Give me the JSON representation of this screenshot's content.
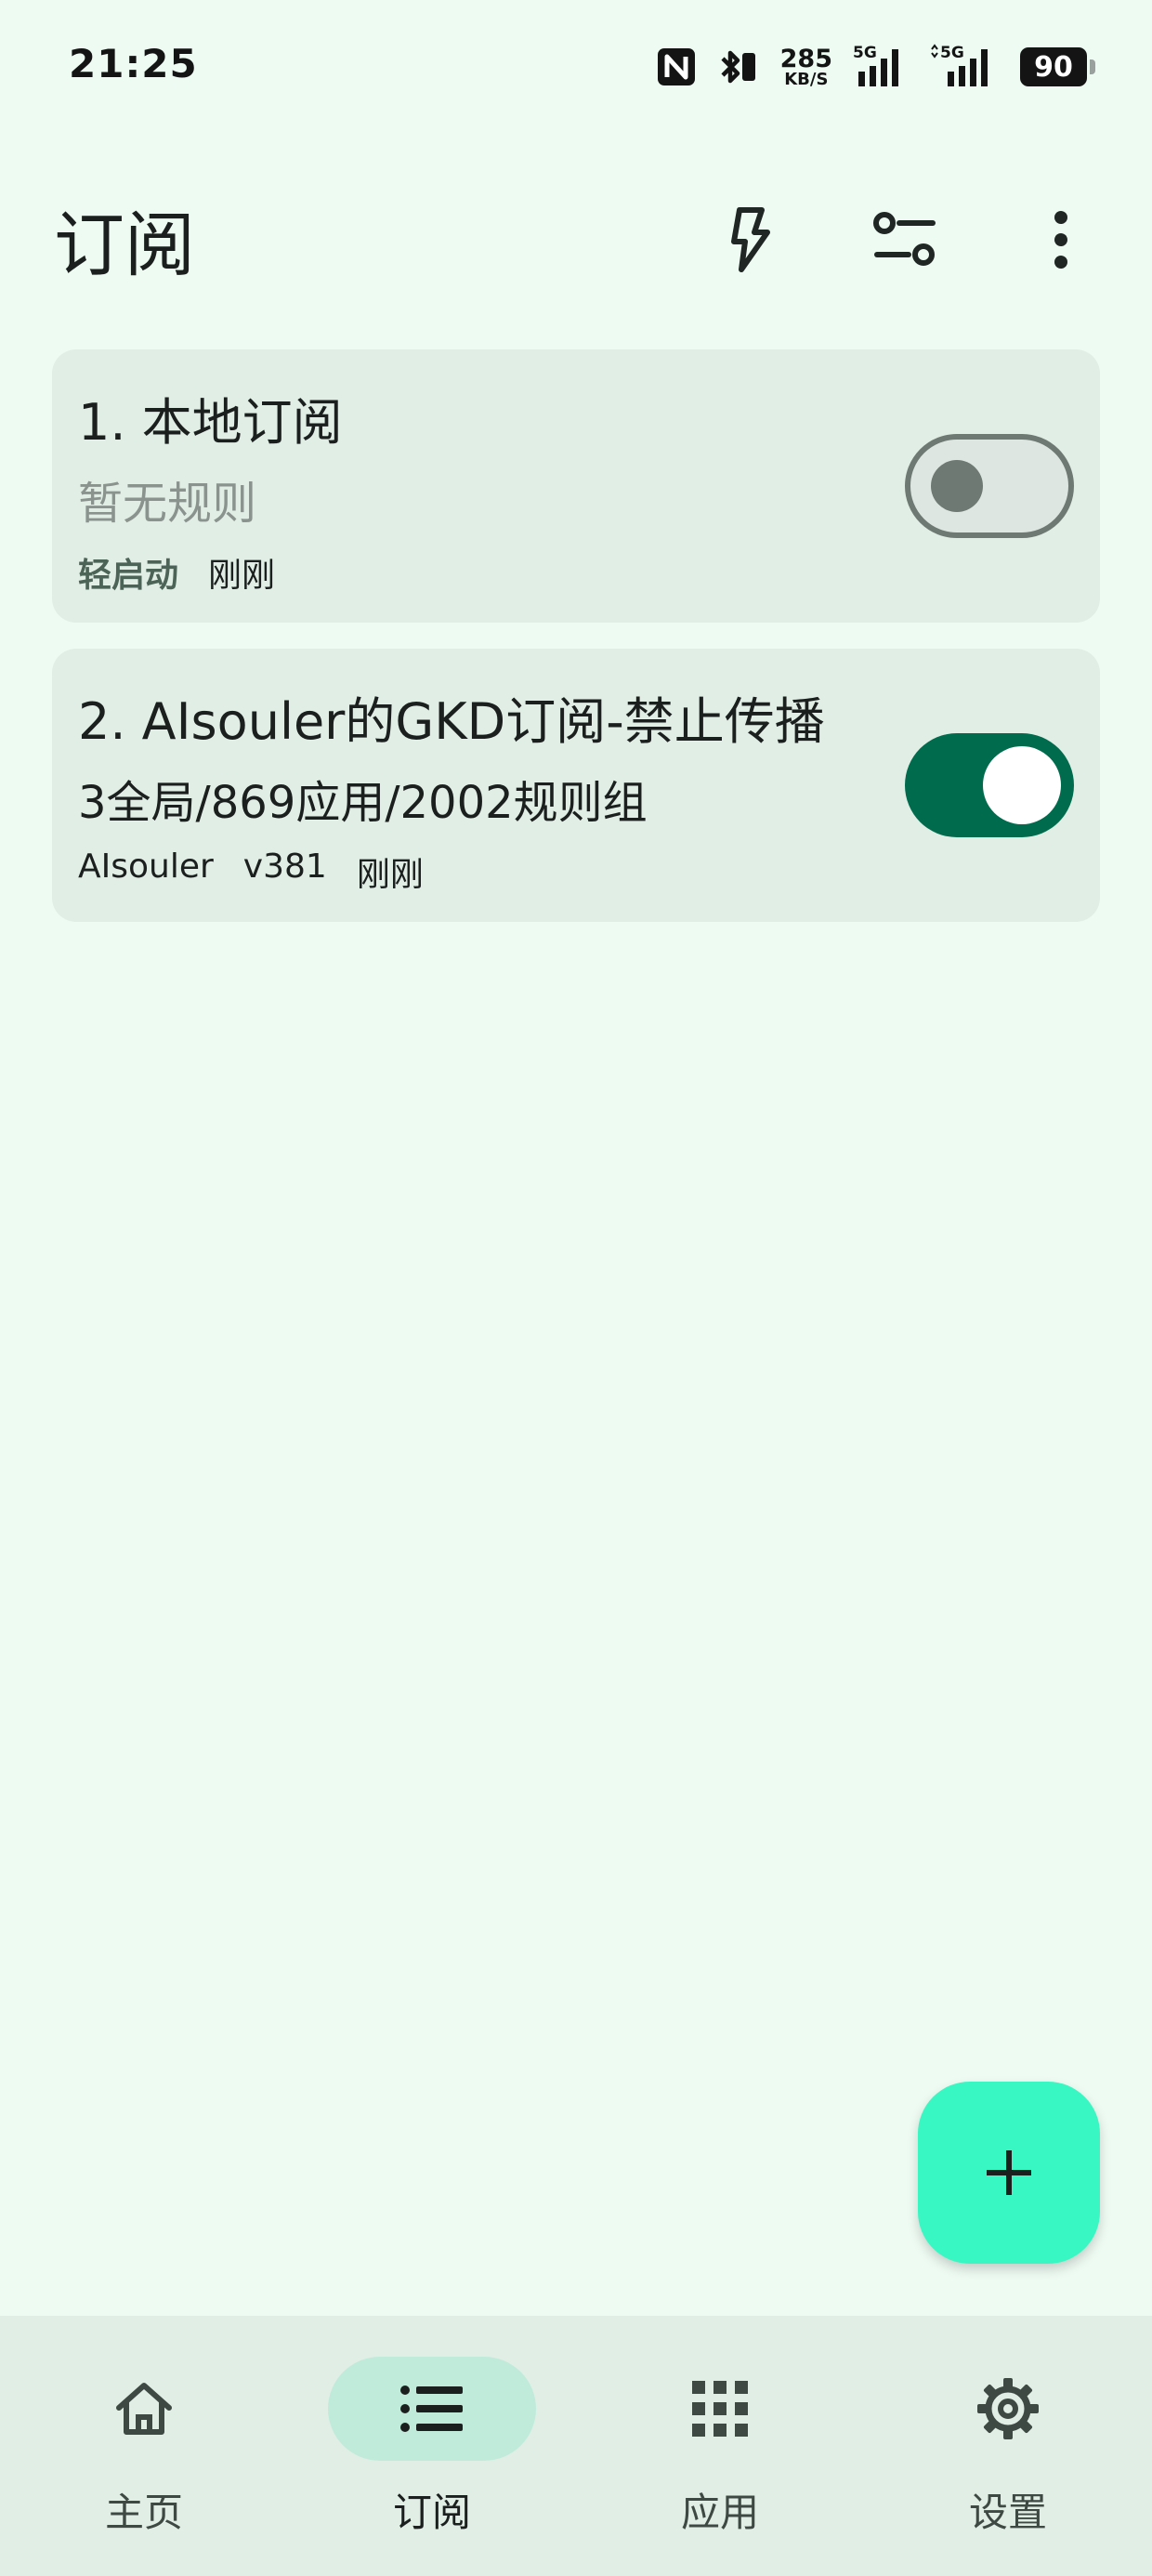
{
  "status_bar": {
    "time": "21:25",
    "net_speed_value": "285",
    "net_speed_unit": "KB/S",
    "signal1_label": "5G",
    "signal2_label": "5G",
    "battery": "90",
    "icons": [
      "nfc-icon",
      "bluetooth-icon",
      "signal-icon",
      "signal-icon",
      "battery-icon"
    ]
  },
  "top_bar": {
    "title": "订阅",
    "actions": [
      "flash-icon",
      "filter-settings-icon",
      "more-vertical-icon"
    ]
  },
  "subscriptions": [
    {
      "title": "1. 本地订阅",
      "description": "暂无规则",
      "meta": [
        "轻启动",
        "刚刚"
      ],
      "enabled": false
    },
    {
      "title": "2. AIsouler的GKD订阅-禁止传播",
      "description": "3全局/869应用/2002规则组",
      "meta": [
        "AIsouler",
        "v381",
        "刚刚"
      ],
      "enabled": true
    }
  ],
  "fab": {
    "icon": "plus-icon"
  },
  "bottom_nav": {
    "items": [
      {
        "label": "主页",
        "icon": "home-icon",
        "active": false
      },
      {
        "label": "订阅",
        "icon": "list-icon",
        "active": true
      },
      {
        "label": "应用",
        "icon": "apps-grid-icon",
        "active": false
      },
      {
        "label": "设置",
        "icon": "gear-icon",
        "active": false
      }
    ]
  },
  "colors": {
    "background": "#EEFBF3",
    "card": "#E1EEE6",
    "primary": "#006C4D",
    "fab": "#38F7C2",
    "nav_active_pill": "#C0EBDB",
    "meta_accent": "#4C6358"
  }
}
